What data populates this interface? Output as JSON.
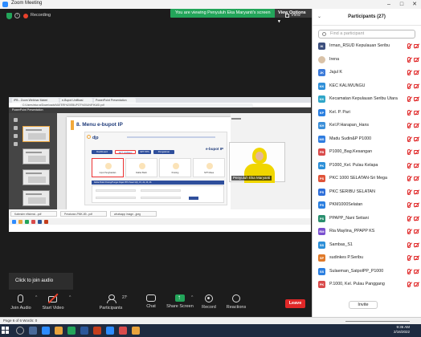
{
  "window": {
    "title": "Zoom Meeting"
  },
  "banner": {
    "viewing": "You are viewing Penyuluh Eka Maryanti's screen",
    "view_options": "View Options ▾"
  },
  "status": {
    "recording": "Recording",
    "view": "View"
  },
  "shared_screen": {
    "tabs": [
      "IPB - Zoom Webinar Materi",
      "e-Bupot Unifikasi",
      "PowerPoint Presentation"
    ],
    "url": "C:/Users/eka.ra/Downloads/MATERI%20EBUPOT%20UNIFIKASI.pdf",
    "ppt_title": "PowerPoint Presentation",
    "slide_title": "8. Menu e-bupot IP",
    "site_logo": "djp",
    "site_product": "e-bupot IP",
    "nav_buttons": [
      "Dashboard",
      "SPT Unifikasi",
      "SPT PPh",
      "Pengaturan"
    ],
    "cards": [
      "Input Penghasilan",
      "Daftar Bukti",
      "Posting",
      "SPT Masa"
    ],
    "section_bar": "Daftar Bukti Potong/Pungut Pajak PPh Pasal 4(2), 15, 22, 23, 26",
    "presenter_name": "Penyuluh Eka Maryanti",
    "downloads": [
      "Kalender efisiensi...pdf",
      "Peraturan-PMK-89...pdf",
      "whatsapp image...jpeg"
    ]
  },
  "click_audio": "Click to join audio",
  "toolbar": {
    "join_audio": "Join Audio",
    "start_video": "Start Video",
    "participants": "Participants",
    "participants_count": "27",
    "chat": "Chat",
    "share_screen": "Share Screen",
    "record": "Record",
    "reactions": "Reactions",
    "leave": "Leave"
  },
  "panel": {
    "title": "Participants (27)",
    "search_placeholder": "Find a participant",
    "invite": "Invite",
    "participants": [
      {
        "initials": "IK",
        "name": "Irman_RSUD Kepulauan Seribu",
        "color": "#3c4f7d"
      },
      {
        "initials": "",
        "name": "Irena",
        "color": "#ffffff",
        "photo": true
      },
      {
        "initials": "JK",
        "name": "Jajul K",
        "color": "#3d7bd9"
      },
      {
        "initials": "KK",
        "name": "KEC KALIWUNGU",
        "color": "#2f8fd8"
      },
      {
        "initials": "KK",
        "name": "Kecamatan Kepulauan Seribu Utara",
        "color": "#2fa6c8"
      },
      {
        "initials": "KP",
        "name": "Kel. P. Pari",
        "color": "#2b7fe0"
      },
      {
        "initials": "KH",
        "name": "Kel.P.Harapan_Hans",
        "color": "#3b8fd9"
      },
      {
        "initials": "MS",
        "name": "Madu Sudin&P P1000",
        "color": "#2f7de0"
      },
      {
        "initials": "PB",
        "name": "P1000_Bag.Kesangan",
        "color": "#d94b4b"
      },
      {
        "initials": "PK",
        "name": "P1000_Kel. Pulau Kelapa",
        "color": "#2c8fd8"
      },
      {
        "initials": "PS",
        "name": "PKC 1000 SELATAN-Sri Mega",
        "color": "#e0543a"
      },
      {
        "initials": "PS",
        "name": "PKC SERIBU SELATAN",
        "color": "#2f6fd9"
      },
      {
        "initials": "PS",
        "name": "PKM1000Selatan",
        "color": "#2b7fe0"
      },
      {
        "initials": "PS",
        "name": "PPAPP_Nani Setiani",
        "color": "#2a8f6f"
      },
      {
        "initials": "RM",
        "name": "Ria Maylina_PPAPP KS",
        "color": "#7a4fcf"
      },
      {
        "initials": "SS",
        "name": "Sambas_S1",
        "color": "#2c8fd8"
      },
      {
        "initials": "SP",
        "name": "sudinkes P.Seribu",
        "color": "#e07a2a"
      },
      {
        "initials": "SS",
        "name": "Sulaeman_SatpolPP_P1000",
        "color": "#2b7fe0"
      },
      {
        "initials": "PK",
        "name": "P.1000, Kel. Pulau Panggang",
        "color": "#d94b4b"
      }
    ]
  },
  "windows": {
    "page_status": "Page 6 of 6     Words: 0",
    "clock_time": "9:36 AM",
    "clock_date": "2/16/2022"
  }
}
